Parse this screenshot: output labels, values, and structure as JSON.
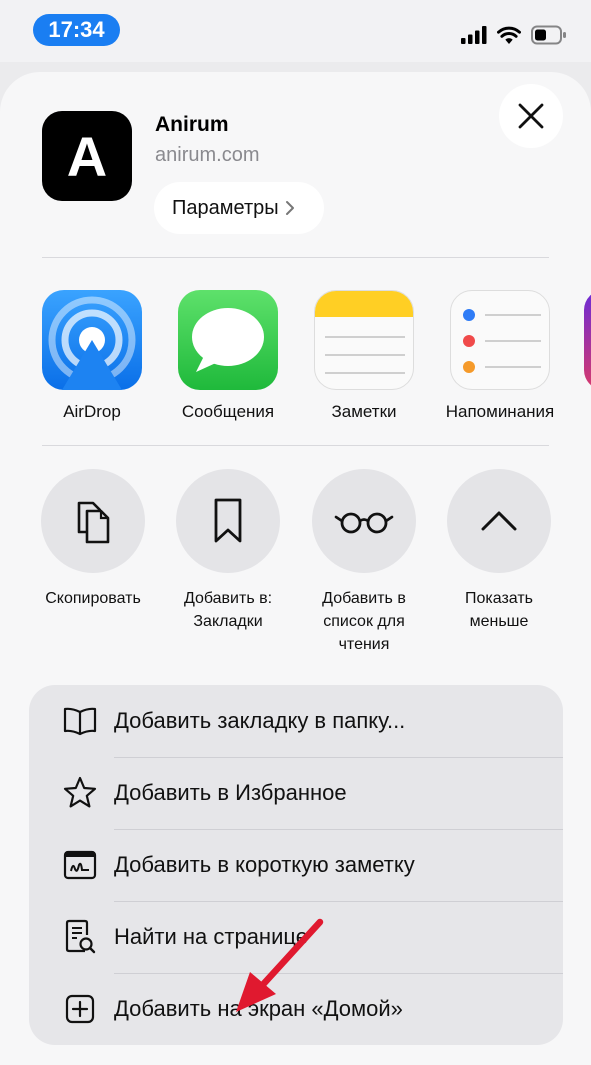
{
  "status_bar": {
    "time": "17:34",
    "icons": [
      "signal-icon",
      "wifi-icon",
      "battery-icon"
    ]
  },
  "header": {
    "app_name": "Anirum",
    "app_url": "anirum.com",
    "app_icon_letter": "A",
    "params_label": "Параметры",
    "close_icon": "close-icon"
  },
  "share_targets": [
    {
      "label": "AirDrop",
      "icon": "airdrop-icon"
    },
    {
      "label": "Сообщения",
      "icon": "messages-icon"
    },
    {
      "label": "Заметки",
      "icon": "notes-icon"
    },
    {
      "label": "Напоминания",
      "icon": "reminders-icon"
    }
  ],
  "actions": [
    {
      "label": "Скопировать",
      "icon": "copy-icon"
    },
    {
      "label": "Добавить в: Закладки",
      "icon": "bookmark-icon"
    },
    {
      "label": "Добавить в список для чтения",
      "icon": "reading-list-icon"
    },
    {
      "label": "Показать меньше",
      "icon": "chevron-up-icon"
    }
  ],
  "menu": [
    {
      "label": "Добавить закладку в папку...",
      "icon": "book-icon"
    },
    {
      "label": "Добавить в Избранное",
      "icon": "star-icon"
    },
    {
      "label": "Добавить в короткую заметку",
      "icon": "quick-note-icon"
    },
    {
      "label": "Найти на странице",
      "icon": "find-page-icon"
    },
    {
      "label": "Добавить на экран «Домой»",
      "icon": "add-square-icon"
    }
  ],
  "colors": {
    "time_pill": "#1a7ef2",
    "annotation_arrow": "#e0192f"
  }
}
